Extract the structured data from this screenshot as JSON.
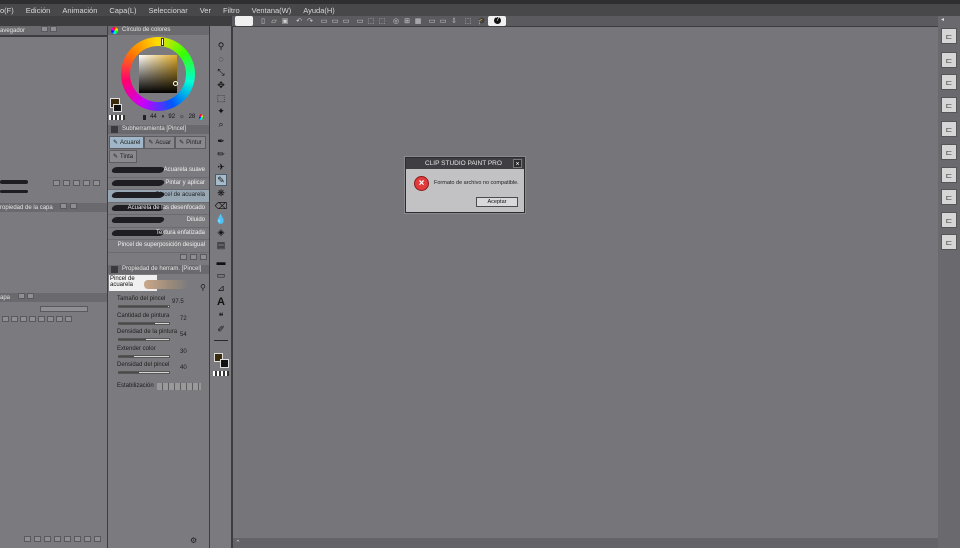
{
  "menu": [
    "o(F)",
    "Edición",
    "Animación",
    "Capa(L)",
    "Seleccionar",
    "Ver",
    "Filtro",
    "Ventana(W)",
    "Ayuda(H)"
  ],
  "left_panel": {
    "navigator_tab": "avegador",
    "layer_property_tab": "ropiedad de la capa",
    "layer_tab": "apa"
  },
  "color_panel": {
    "title": "Círculo de colores",
    "h": "44",
    "s": "92",
    "v": "28",
    "main_color": "#3a2a0c"
  },
  "subtool_panel": {
    "title": "Subherramienta [Pincel]",
    "tabs": [
      "Acuarel",
      "Acuar",
      "Pintur",
      "Tinta"
    ],
    "brushes": [
      "Acuarela suave",
      "Pintar y aplicar",
      "Pincel de acuarela",
      "Acuarela de las desenfocado",
      "Diluido",
      "Textura enfatizada",
      "Pincel de superposición desigual"
    ],
    "active_brush_index": 2
  },
  "tool_property_panel": {
    "title": "Propiedad de herram. [Pincel]",
    "tool_name": "Pincel de acuarela",
    "properties": [
      {
        "label": "Tamaño del pincel",
        "value": "97.5",
        "fill": 0.97
      },
      {
        "label": "Cantidad de pintura",
        "value": "72",
        "fill": 0.72
      },
      {
        "label": "Densidad de la pintura",
        "value": "54",
        "fill": 0.54
      },
      {
        "label": "Extender color",
        "value": "30",
        "fill": 0.3
      },
      {
        "label": "Densidad del pincel",
        "value": "40",
        "fill": 0.4
      }
    ],
    "stabilization_label": "Estabilización"
  },
  "dialog": {
    "title": "CLIP STUDIO PAINT PRO",
    "message": "Formato de archivo no compatible.",
    "ok_label": "Aceptar",
    "close_glyph": "×",
    "error_glyph": "×"
  },
  "icons": {
    "tools": [
      "zoom",
      "move",
      "transform",
      "pick",
      "eyedropper",
      "pen",
      "pencil",
      "brush",
      "airbrush",
      "decoration",
      "eraser",
      "blend",
      "fill",
      "gradient",
      "figure",
      "frame",
      "ruler",
      "text",
      "balloon",
      "correct"
    ],
    "right_buttons": 11
  },
  "colors": {
    "accent": "#a7bccb",
    "error": "#e23b3b"
  }
}
